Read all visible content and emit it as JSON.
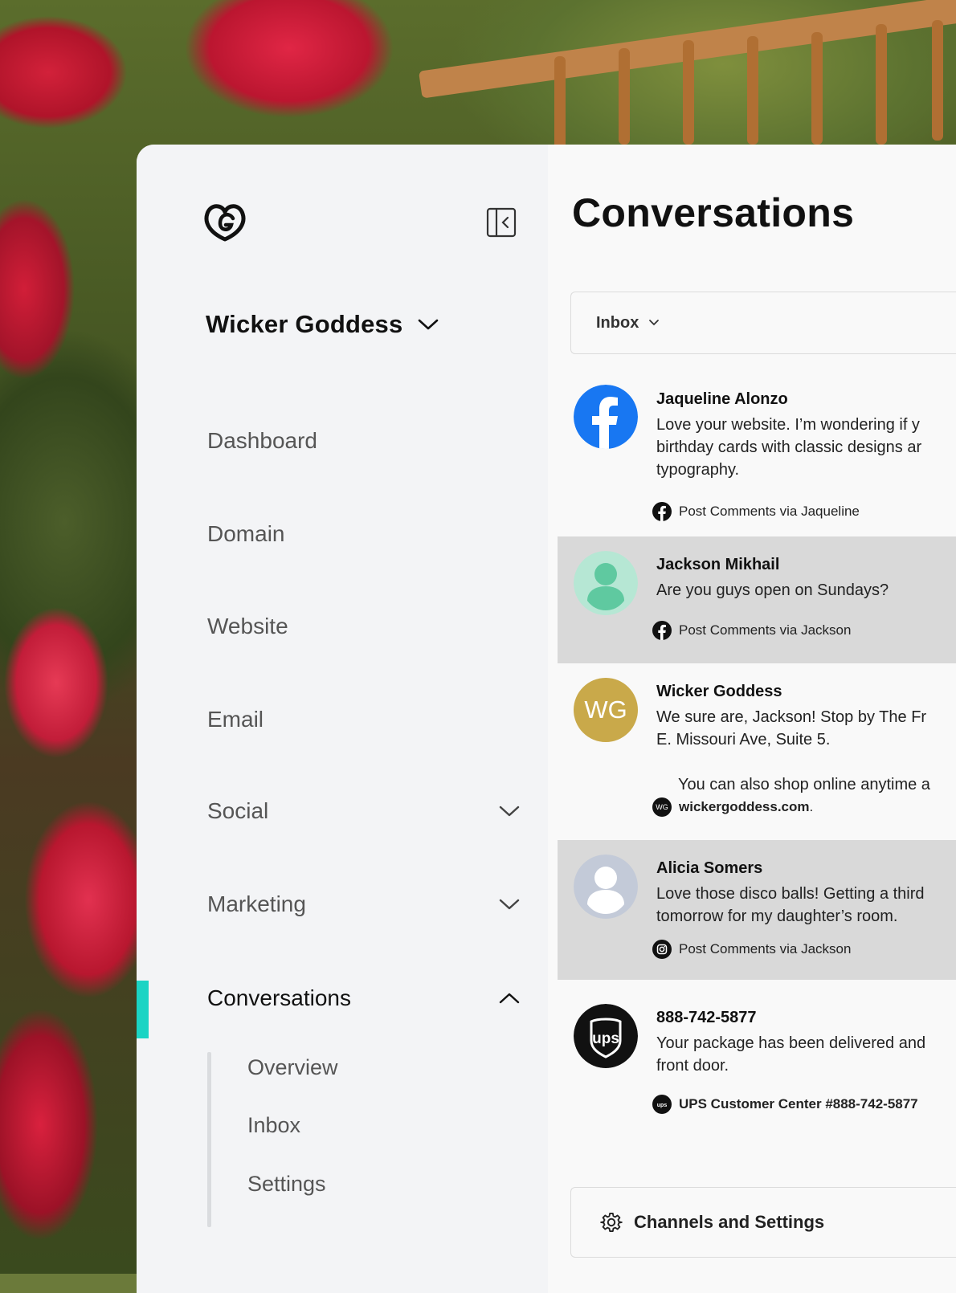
{
  "brand": {
    "name": "Wicker Goddess",
    "logo_icon": "godaddy-logo-icon"
  },
  "nav": {
    "items": [
      {
        "label": "Dashboard"
      },
      {
        "label": "Domain"
      },
      {
        "label": "Website"
      },
      {
        "label": "Email"
      },
      {
        "label": "Social",
        "has_chevron": true
      },
      {
        "label": "Marketing",
        "has_chevron": true
      },
      {
        "label": "Conversations",
        "has_chevron": true,
        "expanded": true,
        "active": true
      }
    ],
    "sub_items": [
      {
        "label": "Overview"
      },
      {
        "label": "Inbox"
      },
      {
        "label": "Settings"
      }
    ]
  },
  "main": {
    "title": "Conversations",
    "filter": {
      "selected": "Inbox"
    },
    "conversations": [
      {
        "name": "Jaqueline Alonzo",
        "message_lines": [
          "Love your website. I’m wondering if y",
          "birthday cards with classic designs ar",
          "typography."
        ],
        "source": "Post Comments via Jaqueline",
        "source_icon": "facebook-icon",
        "avatar": "facebook-icon",
        "highlighted": false
      },
      {
        "name": "Jackson Mikhail",
        "message_lines": [
          "Are you guys open on Sundays?"
        ],
        "source": "Post Comments via Jackson",
        "source_icon": "facebook-icon",
        "avatar": "person-avatar-green",
        "highlighted": true
      },
      {
        "name": "Wicker Goddess",
        "message_lines": [
          "We sure are, Jackson! Stop by The Fr",
          "E. Missouri Ave, Suite 5."
        ],
        "extra_line": "You can also shop online anytime a",
        "link_text": "wickergoddess.com",
        "link_suffix": ".",
        "avatar_initials": "WG",
        "source_icon": "wg-badge-icon",
        "highlighted": false
      },
      {
        "name": "Alicia Somers",
        "message_lines": [
          "Love those disco balls! Getting a third",
          "tomorrow for my daughter’s room."
        ],
        "source": "Post Comments via Jackson",
        "source_icon": "instagram-icon",
        "avatar": "person-avatar-gray",
        "highlighted": true
      },
      {
        "name": "888-742-5877",
        "message_lines": [
          "Your package has been delivered and",
          "front door."
        ],
        "source": "UPS Customer Center #888-742-5877",
        "source_icon": "ups-icon",
        "avatar": "ups-logo-icon",
        "highlighted": false
      }
    ],
    "footer": {
      "label": "Channels and Settings",
      "icon": "gear-icon"
    }
  },
  "colors": {
    "active_indicator": "#1bd4c4",
    "facebook_blue": "#1877f2",
    "wg_gold": "#c9a94a",
    "highlight_row": "#d9d9d9",
    "sidebar_bg": "#f3f4f6"
  }
}
